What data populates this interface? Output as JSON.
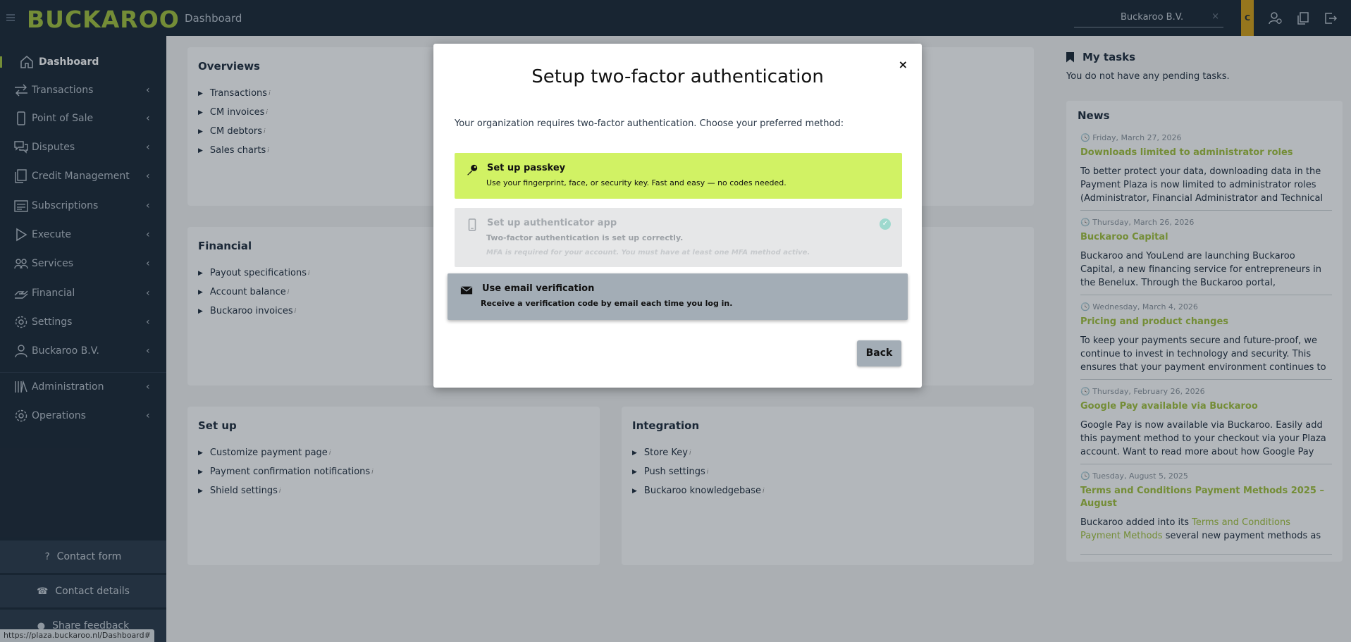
{
  "topbar": {
    "logo": "BUCKAROO",
    "title": "Dashboard",
    "org_select": "Buckaroo B.V.",
    "org_clear": "×",
    "user_initial": "C"
  },
  "sidebar": {
    "items": [
      {
        "label": "Dashboard",
        "icon": "home-icon"
      },
      {
        "label": "Transactions",
        "icon": "transfer-icon"
      },
      {
        "label": "Point of Sale",
        "icon": "mobile-icon"
      },
      {
        "label": "Disputes",
        "icon": "chat-icon"
      },
      {
        "label": "Credit Management",
        "icon": "documents-icon"
      },
      {
        "label": "Subscriptions",
        "icon": "calendar-list-icon"
      },
      {
        "label": "Execute",
        "icon": "play-icon"
      },
      {
        "label": "Services",
        "icon": "people-icon"
      },
      {
        "label": "Financial",
        "icon": "cash-icon"
      },
      {
        "label": "Settings",
        "icon": "gear-icon"
      },
      {
        "label": "Buckaroo B.V.",
        "icon": "user-icon"
      },
      {
        "label": "Administration",
        "icon": "library-icon"
      },
      {
        "label": "Operations",
        "icon": "cog-icon"
      }
    ],
    "chevron": "‹",
    "contact_form": "Contact form",
    "contact_details": "Contact details",
    "share_feedback": "Share feedback"
  },
  "status_url": "https://plaza.buckaroo.nl/Dashboard#",
  "panels": {
    "overviews": {
      "title": "Overviews",
      "links": [
        "Transactions",
        "CM invoices",
        "CM debtors",
        "Sales charts"
      ]
    },
    "financial": {
      "title": "Financial",
      "links": [
        "Payout specifications",
        "Account balance",
        "Buckaroo invoices"
      ]
    },
    "setup": {
      "title": "Set up",
      "links": [
        "Customize payment page",
        "Payment confirmation notifications",
        "Shield settings"
      ]
    },
    "integration": {
      "title": "Integration",
      "links": [
        "Store Key",
        "Push settings",
        "Buckaroo knowledgebase"
      ]
    },
    "info_mark": "i"
  },
  "tasks": {
    "title": "My tasks",
    "text": "You do not have any pending tasks."
  },
  "news": {
    "title": "News",
    "items": [
      {
        "date": "Friday, March 27, 2026",
        "title": "Downloads limited to administrator roles",
        "body": "To better protect your data, downloading data in the Payment Plaza is now limited to administrator roles (Administrator, Financial Administrator and Technical"
      },
      {
        "date": "Thursday, March 26, 2026",
        "title": "Buckaroo Capital",
        "body": "Buckaroo and YouLend are launching Buckaroo Capital, a new financing service for entrepreneurs in the Benelux. Through the Buckaroo portal,"
      },
      {
        "date": "Wednesday, March 4, 2026",
        "title": "Pricing and product changes",
        "body": "To keep your payments secure and future-proof, we continue to invest in technology and security. This ensures that your payment environment continues to"
      },
      {
        "date": "Thursday, February 26, 2026",
        "title": "Google Pay available via Buckaroo",
        "body": "Google Pay is now available via Buckaroo. Easily add this payment method to your checkout via your Plaza account. Want to read more about how Google Pay"
      },
      {
        "date": "Tuesday, August 5, 2025",
        "title": "Terms and Conditions Payment Methods 2025 – August",
        "body_pre": "Buckaroo added into its ",
        "body_link": "Terms and Conditions Payment Methods",
        "body_post": " several new payment methods as"
      }
    ]
  },
  "modal": {
    "close": "×",
    "title": "Setup two-factor authentication",
    "intro": "Your organization requires two-factor authentication. Choose your preferred method:",
    "passkey": {
      "title": "Set up passkey",
      "desc": "Use your fingerprint, face, or security key. Fast and easy — no codes needed.",
      "icon": "key-icon"
    },
    "authenticator": {
      "title": "Set up authenticator app",
      "desc": "Two-factor authentication is set up correctly.",
      "note": "MFA is required for your account. You must have at least one MFA method active.",
      "icon": "phone-icon",
      "check": "✓"
    },
    "email": {
      "title": "Use email verification",
      "desc": "Receive a verification code by email each time you log in.",
      "icon": "envelope-icon"
    },
    "back": "Back"
  },
  "colors": {
    "brand_green": "#a3c23d",
    "passkey_bg": "#d1f264",
    "sidebar_bg": "#1b2836"
  }
}
